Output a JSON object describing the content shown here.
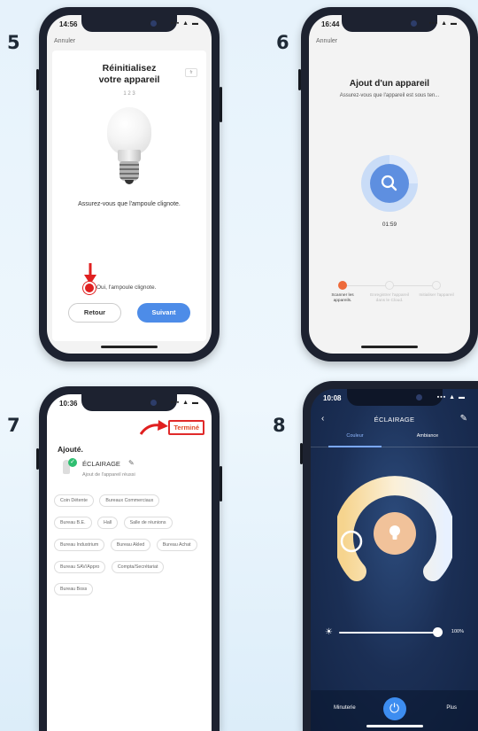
{
  "steps": {
    "s5": "5",
    "s6": "6",
    "s7": "7",
    "s8": "8"
  },
  "phone5": {
    "time": "14:56",
    "status_icons": "▪▪▪ ▲ ▬",
    "cancel": "Annuler",
    "title_line1": "Réinitialisez",
    "title_line2": "votre appareil",
    "page_steps": "1 2 3",
    "message": "Assurez-vous que l'ampoule clignote.",
    "radio_label": "Oui, l'ampoule clignote.",
    "back_button": "Retour",
    "next_button": "Suivant"
  },
  "phone6": {
    "time": "16:44",
    "status_icons": "▪▪▪ ▲ ▬",
    "cancel": "Annuler",
    "title": "Ajout d'un appareil",
    "subtitle": "Assurez-vous que l'appareil est sous ten...",
    "countdown": "01:59",
    "progress_steps": [
      {
        "label": "Scanner les appareils.",
        "active": true
      },
      {
        "label": "Enregistrer l'appareil dans le Cloud.",
        "active": false
      },
      {
        "label": "Initialiser l'appareil",
        "active": false
      }
    ]
  },
  "phone7": {
    "time": "10:36",
    "status_icons": "▪▪▪ ▲ ▬",
    "done_button": "Terminé",
    "added_heading": "Ajouté.",
    "device_name": "ÉCLAIRAGE",
    "device_status": "Ajout de l'appareil réussi",
    "rooms": [
      "Coin Détente",
      "Bureaux Commerciaux",
      "Bureau B.E.",
      "Hall",
      "Salle de réunions",
      "Bureau Industrium",
      "Bureau Akled",
      "Bureau Achat",
      "Bureau SAV/Appro",
      "Compta/Secrétariat",
      "Bureau Boss"
    ]
  },
  "phone8": {
    "time": "10:08",
    "status_icons": "▪▪▪ ▲ ▬",
    "title": "ÉCLAIRAGE",
    "tab_color": "Couleur",
    "tab_ambiance": "Ambiance",
    "brightness": "100%",
    "brightness_value": 1.0,
    "timer_label": "Minuterie",
    "more_label": "Plus"
  },
  "colors": {
    "accent_blue": "#4d8ce8",
    "highlight_red": "#e02020",
    "step_orange": "#ee6a3a",
    "success_green": "#2fbf71",
    "dark_navy": "#1b2f55"
  }
}
